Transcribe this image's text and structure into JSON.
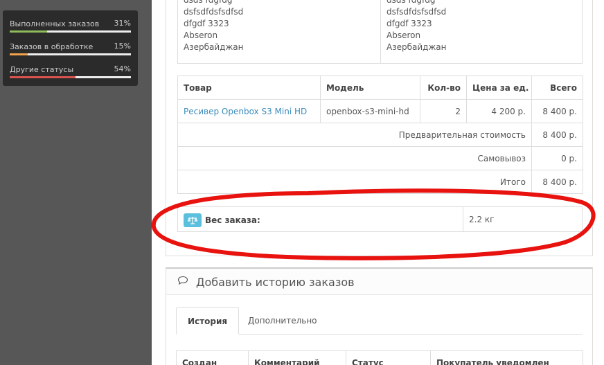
{
  "sidebar": {
    "stats": [
      {
        "label": "Выполненных заказов",
        "percent": "31%",
        "value": 0.31,
        "color": "#8fbb5c"
      },
      {
        "label": "Заказов в обработке",
        "percent": "15%",
        "value": 0.15,
        "color": "#f0a24b"
      },
      {
        "label": "Другие статусы",
        "percent": "54%",
        "value": 0.54,
        "color": "#d9534f"
      }
    ]
  },
  "address": {
    "payment": [
      "dsds fdgfdg",
      "dsfsdfdsfsdfsd",
      "dfgdf 3323",
      "Abseron",
      "Азербайджан"
    ],
    "shipping": [
      "dsds fdgfdg",
      "dsfsdfdsfsdfsd",
      "dfgdf 3323",
      "Abseron",
      "Азербайджан"
    ]
  },
  "products": {
    "headers": {
      "product": "Товар",
      "model": "Модель",
      "qty": "Кол-во",
      "price": "Цена за ед.",
      "total": "Всего"
    },
    "item": {
      "name": "Ресивер Openbox S3 Mini HD",
      "model": "openbox-s3-mini-hd",
      "qty": "2",
      "price": "4 200 р.",
      "total": "8 400 р."
    },
    "totals": [
      {
        "label": "Предварительная стоимость",
        "value": "8 400 р."
      },
      {
        "label": "Самовывоз",
        "value": "0 р."
      },
      {
        "label": "Итого",
        "value": "8 400 р."
      }
    ]
  },
  "weight": {
    "label": "Вес заказа:",
    "value": "2.2 кг",
    "icon": "balance-scale-icon"
  },
  "history": {
    "title": "Добавить историю заказов",
    "icon": "comment-icon",
    "tabs": {
      "history": "История",
      "additional": "Дополнительно"
    },
    "columns": [
      "Создан",
      "Комментарий",
      "Статус",
      "Покупатель уведомлен"
    ]
  },
  "annotation_color": "#e8120f"
}
